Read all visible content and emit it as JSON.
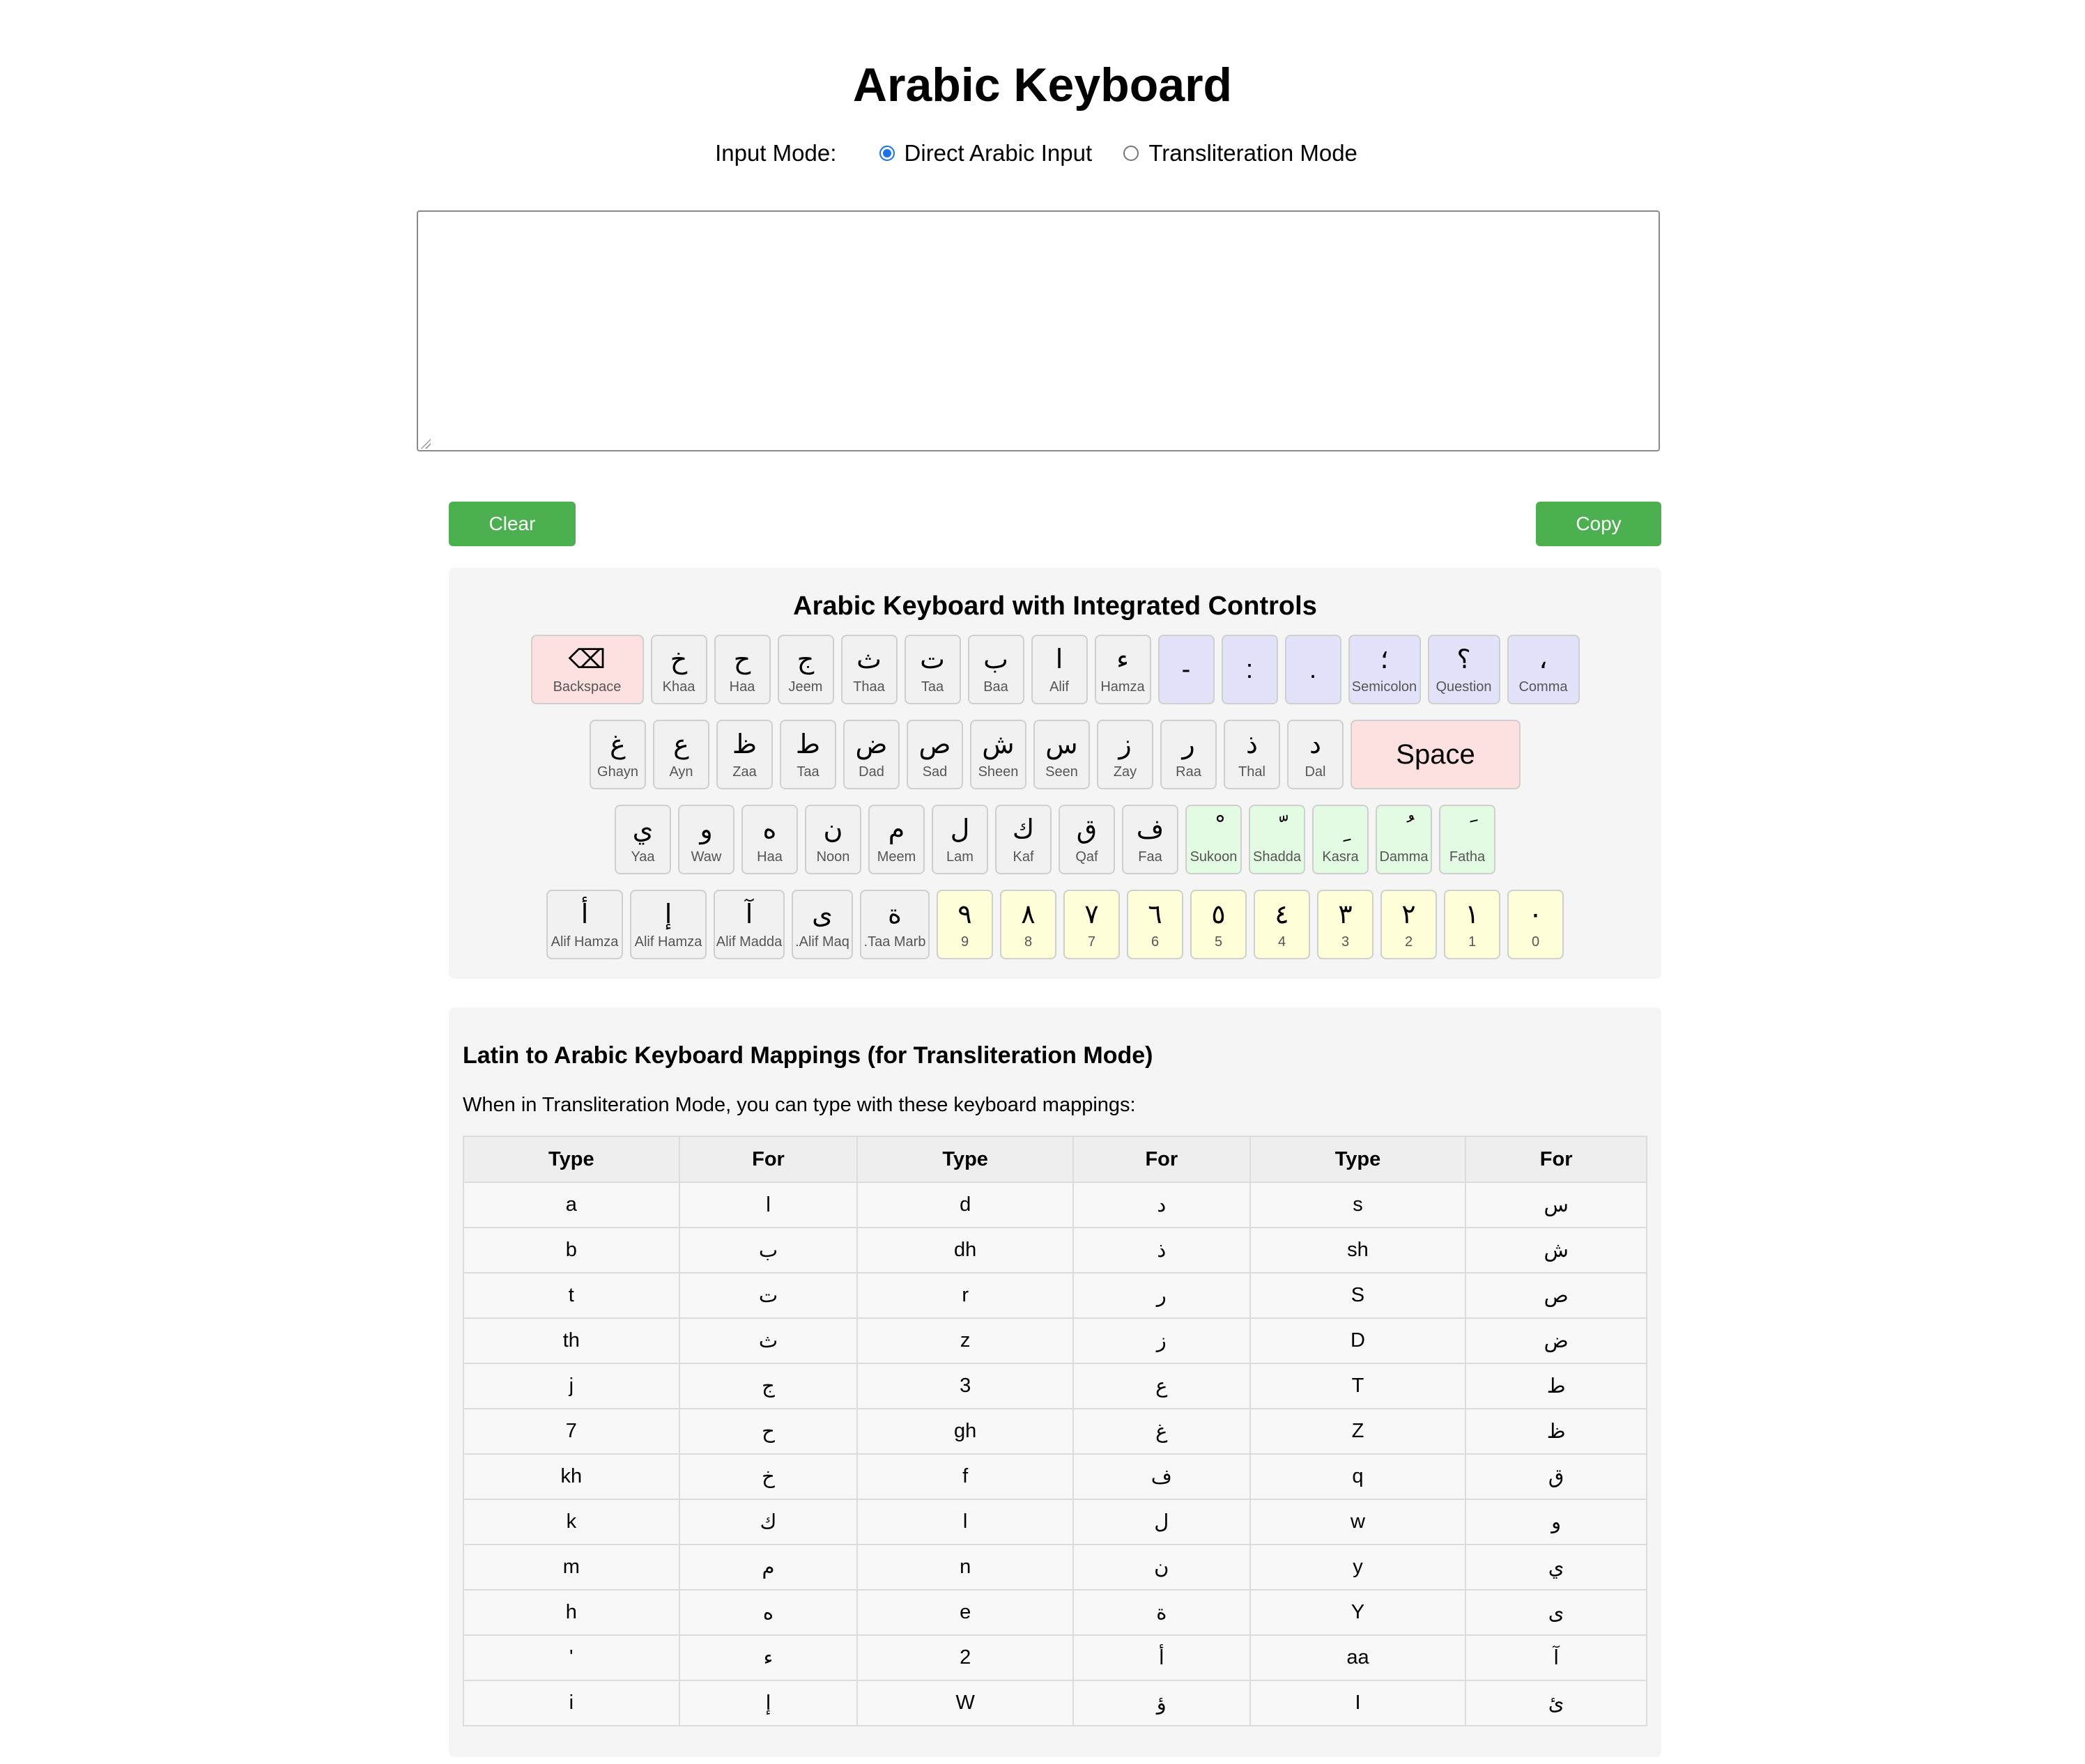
{
  "title": "Arabic Keyboard",
  "input_mode": {
    "label": "Input Mode:",
    "options": [
      {
        "label": "Direct Arabic Input",
        "selected": true
      },
      {
        "label": "Transliteration Mode",
        "selected": false
      }
    ]
  },
  "text_area": {
    "value": ""
  },
  "buttons": {
    "clear": "Clear Text",
    "copy": "Copy Text"
  },
  "keyboard": {
    "title": "Arabic Keyboard with Integrated Controls",
    "row1": [
      {
        "ch": "⌫",
        "name": "Backspace"
      },
      {
        "ch": "خ",
        "name": "Khaa"
      },
      {
        "ch": "ح",
        "name": "Haa"
      },
      {
        "ch": "ج",
        "name": "Jeem"
      },
      {
        "ch": "ث",
        "name": "Thaa"
      },
      {
        "ch": "ت",
        "name": "Taa"
      },
      {
        "ch": "ب",
        "name": "Baa"
      },
      {
        "ch": "ا",
        "name": "Alif"
      },
      {
        "ch": "ء",
        "name": "Hamza"
      },
      {
        "ch": "-",
        "name": ""
      },
      {
        "ch": ":",
        "name": ""
      },
      {
        "ch": ".",
        "name": ""
      },
      {
        "ch": "؛",
        "name": "Semicolon"
      },
      {
        "ch": "؟",
        "name": "Question"
      },
      {
        "ch": "،",
        "name": "Comma"
      }
    ],
    "row2": [
      {
        "ch": "غ",
        "name": "Ghayn"
      },
      {
        "ch": "ع",
        "name": "Ayn"
      },
      {
        "ch": "ظ",
        "name": "Zaa"
      },
      {
        "ch": "ط",
        "name": "Taa"
      },
      {
        "ch": "ض",
        "name": "Dad"
      },
      {
        "ch": "ص",
        "name": "Sad"
      },
      {
        "ch": "ش",
        "name": "Sheen"
      },
      {
        "ch": "س",
        "name": "Seen"
      },
      {
        "ch": "ز",
        "name": "Zay"
      },
      {
        "ch": "ر",
        "name": "Raa"
      },
      {
        "ch": "ذ",
        "name": "Thal"
      },
      {
        "ch": "د",
        "name": "Dal"
      },
      {
        "ch": "Space",
        "name": ""
      }
    ],
    "row3": [
      {
        "ch": "ي",
        "name": "Yaa"
      },
      {
        "ch": "و",
        "name": "Waw"
      },
      {
        "ch": "ه",
        "name": "Haa"
      },
      {
        "ch": "ن",
        "name": "Noon"
      },
      {
        "ch": "م",
        "name": "Meem"
      },
      {
        "ch": "ل",
        "name": "Lam"
      },
      {
        "ch": "ك",
        "name": "Kaf"
      },
      {
        "ch": "ق",
        "name": "Qaf"
      },
      {
        "ch": "ف",
        "name": "Faa"
      },
      {
        "ch": "ْ",
        "name": "Sukoon"
      },
      {
        "ch": "ّ",
        "name": "Shadda"
      },
      {
        "ch": "ِ",
        "name": "Kasra"
      },
      {
        "ch": "ُ",
        "name": "Damma"
      },
      {
        "ch": "َ",
        "name": "Fatha"
      }
    ],
    "row4": [
      {
        "ch": "أ",
        "name": "Alif Hamza"
      },
      {
        "ch": "إ",
        "name": "Alif Hamza"
      },
      {
        "ch": "آ",
        "name": "Alif Madda"
      },
      {
        "ch": "ى",
        "name": ".Alif Maq"
      },
      {
        "ch": "ة",
        "name": ".Taa Marb"
      },
      {
        "ch": "٩",
        "name": "9"
      },
      {
        "ch": "٨",
        "name": "8"
      },
      {
        "ch": "٧",
        "name": "7"
      },
      {
        "ch": "٦",
        "name": "6"
      },
      {
        "ch": "٥",
        "name": "5"
      },
      {
        "ch": "٤",
        "name": "4"
      },
      {
        "ch": "٣",
        "name": "3"
      },
      {
        "ch": "٢",
        "name": "2"
      },
      {
        "ch": "١",
        "name": "1"
      },
      {
        "ch": "٠",
        "name": "0"
      }
    ]
  },
  "mappings": {
    "title": "Latin to Arabic Keyboard Mappings (for Transliteration Mode)",
    "description": "When in Transliteration Mode, you can type with these keyboard mappings:",
    "headers": [
      "Type",
      "For",
      "Type",
      "For",
      "Type",
      "For"
    ],
    "rows": [
      [
        "a",
        "ا",
        "d",
        "د",
        "s",
        "س"
      ],
      [
        "b",
        "ب",
        "dh",
        "ذ",
        "sh",
        "ش"
      ],
      [
        "t",
        "ت",
        "r",
        "ر",
        "S",
        "ص"
      ],
      [
        "th",
        "ث",
        "z",
        "ز",
        "D",
        "ض"
      ],
      [
        "j",
        "ج",
        "3",
        "ع",
        "T",
        "ط"
      ],
      [
        "7",
        "ح",
        "gh",
        "غ",
        "Z",
        "ظ"
      ],
      [
        "kh",
        "خ",
        "f",
        "ف",
        "q",
        "ق"
      ],
      [
        "k",
        "ك",
        "l",
        "ل",
        "w",
        "و"
      ],
      [
        "m",
        "م",
        "n",
        "ن",
        "y",
        "ي"
      ],
      [
        "h",
        "ه",
        "e",
        "ة",
        "Y",
        "ى"
      ],
      [
        "'",
        "ء",
        "2",
        "أ",
        "aa",
        "آ"
      ],
      [
        "i",
        "إ",
        "W",
        "ؤ",
        "I",
        "ئ"
      ]
    ]
  }
}
